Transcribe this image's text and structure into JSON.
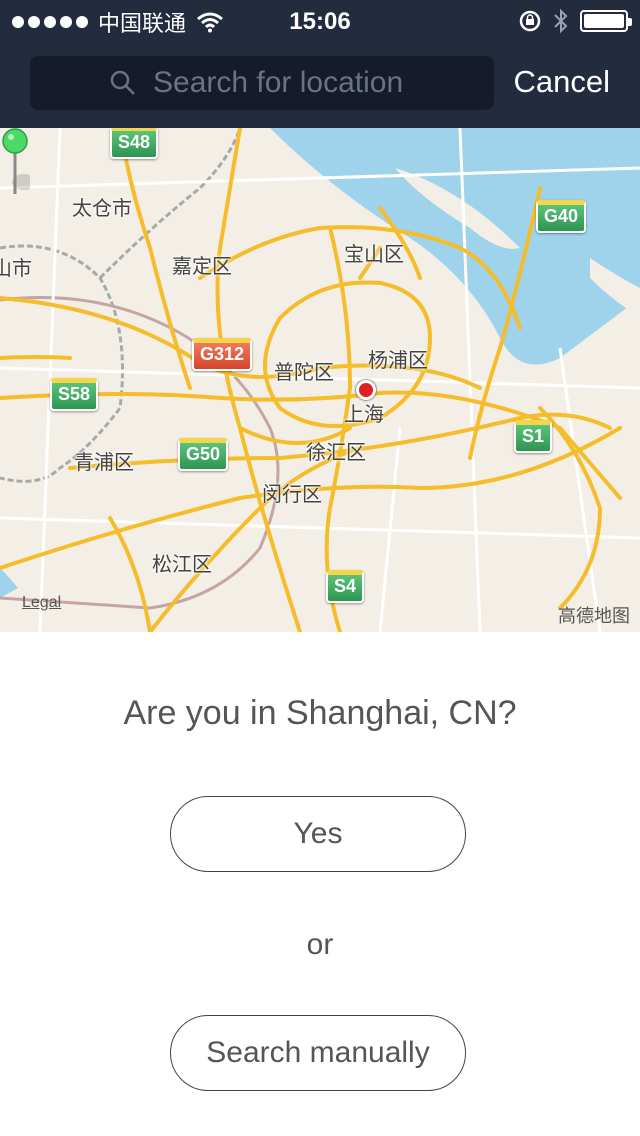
{
  "status_bar": {
    "carrier": "中国联通",
    "time": "15:06"
  },
  "search": {
    "placeholder": "Search for location",
    "cancel_label": "Cancel"
  },
  "map": {
    "labels": {
      "taicang": "太仓市",
      "jiading": "嘉定区",
      "baoshan": "宝山区",
      "putuo": "普陀区",
      "yangpu": "杨浦区",
      "shanghai": "上海",
      "xuhui": "徐汇区",
      "qingpu": "青浦区",
      "minhang": "闵行区",
      "songjiang": "松江区",
      "edge_city": "山市"
    },
    "shields": {
      "s48": "S48",
      "g40": "G40",
      "g312": "G312",
      "s58": "S58",
      "g50": "G50",
      "s1": "S1",
      "s4": "S4"
    },
    "legal": "Legal",
    "provider": "高德地图"
  },
  "prompt": {
    "question": "Are you in Shanghai, CN?",
    "yes": "Yes",
    "or": "or",
    "search_manually": "Search manually"
  }
}
